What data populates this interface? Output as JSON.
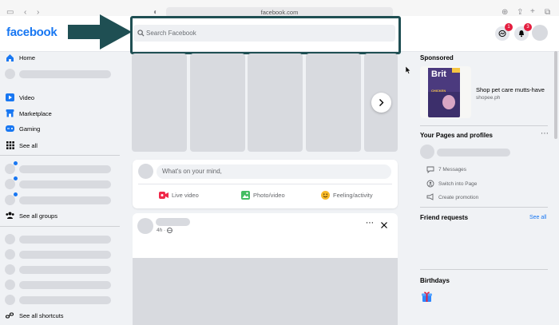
{
  "browser": {
    "url": "facebook.com"
  },
  "header": {
    "logo": "facebook",
    "search_placeholder": "Search Facebook",
    "messenger_badge": "1",
    "notifications_badge": "3"
  },
  "sidebar": {
    "home": "Home",
    "video": "Video",
    "marketplace": "Marketplace",
    "gaming": "Gaming",
    "see_all": "See all",
    "see_all_groups": "See all groups",
    "see_all_shortcuts": "See all shortcuts"
  },
  "composer": {
    "placeholder": "What's on your mind,",
    "live_video": "Live video",
    "photo_video": "Photo/video",
    "feeling_activity": "Feeling/activity"
  },
  "post": {
    "time": "4h ·"
  },
  "right": {
    "sponsored_title": "Sponsored",
    "ad_title": "Shop pet care mutts-have",
    "ad_domain": "shopee.ph",
    "ad_brand": "Brit",
    "ad_flavor": "CHICKEN",
    "pages_title": "Your Pages and profiles",
    "messages": "7 Messages",
    "switch_page": "Switch into Page",
    "create_promotion": "Create promotion",
    "friend_requests": "Friend requests",
    "see_all": "See all",
    "birthdays": "Birthdays"
  },
  "colors": {
    "brand": "#1877f2",
    "highlight_arrow": "#1f4f53",
    "skeleton": "#d8dadf",
    "badge": "#e41e3f"
  }
}
